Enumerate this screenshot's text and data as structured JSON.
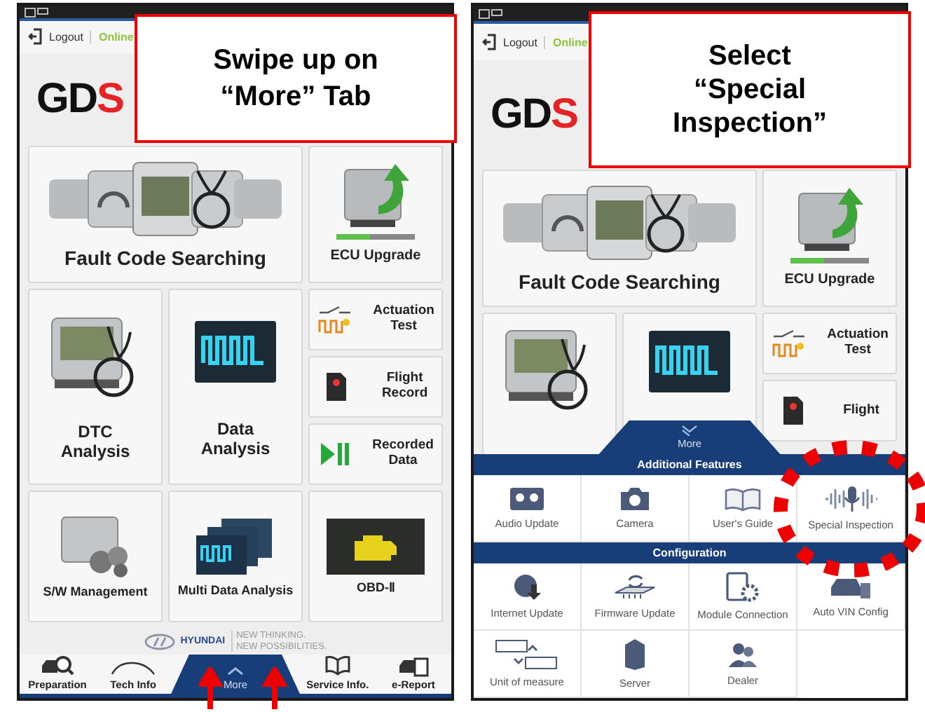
{
  "panels": [
    {
      "callout": "Swipe up on\n“More” Tab",
      "arrows": true,
      "header": {
        "logout": "Logout",
        "status": "Online"
      },
      "logo": {
        "main": "GD",
        "accent": "S"
      },
      "tiles": [
        {
          "label": "Fault Code Searching",
          "kind": "wide"
        },
        {
          "label": "ECU Upgrade",
          "kind": "square"
        },
        {
          "label": "DTC\nAnalysis",
          "kind": "tall"
        },
        {
          "label": "Data\nAnalysis",
          "kind": "tall"
        },
        {
          "label": "Actuation\nTest",
          "kind": "small"
        },
        {
          "label": "Flight\nRecord",
          "kind": "small"
        },
        {
          "label": "Recorded\nData",
          "kind": "small"
        },
        {
          "label": "S/W Management",
          "kind": "square"
        },
        {
          "label": "Multi Data Analysis",
          "kind": "square"
        },
        {
          "label": "OBD-Ⅱ",
          "kind": "square"
        }
      ],
      "brand": {
        "name": "HYUNDAI",
        "slogan": "NEW THINKING.\nNEW POSSIBILITIES."
      },
      "nav": [
        {
          "label": "Preparation",
          "selected": false
        },
        {
          "label": "Tech Info",
          "selected": false
        },
        {
          "label": "More",
          "selected": true
        },
        {
          "label": "Service Info.",
          "selected": false
        },
        {
          "label": "e-Report",
          "selected": false
        }
      ]
    },
    {
      "callout": "Select\n“Special\nInspection”",
      "arrows": false,
      "header": {
        "logout": "Logout",
        "status": "Online"
      },
      "logo": {
        "main": "GD",
        "accent": "S"
      },
      "tiles": [
        {
          "label": "Fault Code Searching",
          "kind": "wide"
        },
        {
          "label": "ECU Upgrade",
          "kind": "square"
        },
        {
          "kind": "tall"
        },
        {
          "kind": "tall"
        },
        {
          "label": "Actuation\nTest",
          "kind": "small"
        },
        {
          "label": "Flight",
          "kind": "small"
        }
      ],
      "drawer": {
        "handle": "More",
        "sections": [
          {
            "title": "Additional Features",
            "items": [
              {
                "label": "Audio Update",
                "highlighted": false
              },
              {
                "label": "Camera",
                "highlighted": false
              },
              {
                "label": "User's Guide",
                "highlighted": false
              },
              {
                "label": "Special Inspection",
                "highlighted": true
              }
            ]
          },
          {
            "title": "Configuration",
            "items": [
              {
                "label": "Internet Update",
                "highlighted": false
              },
              {
                "label": "Firmware Update",
                "highlighted": false
              },
              {
                "label": "Module Connection",
                "highlighted": false
              },
              {
                "label": "Auto VIN Config",
                "highlighted": false
              },
              {
                "label": "Unit of measure",
                "highlighted": false
              },
              {
                "label": "Server",
                "highlighted": false
              },
              {
                "label": "Dealer",
                "highlighted": false
              }
            ]
          }
        ]
      }
    }
  ]
}
